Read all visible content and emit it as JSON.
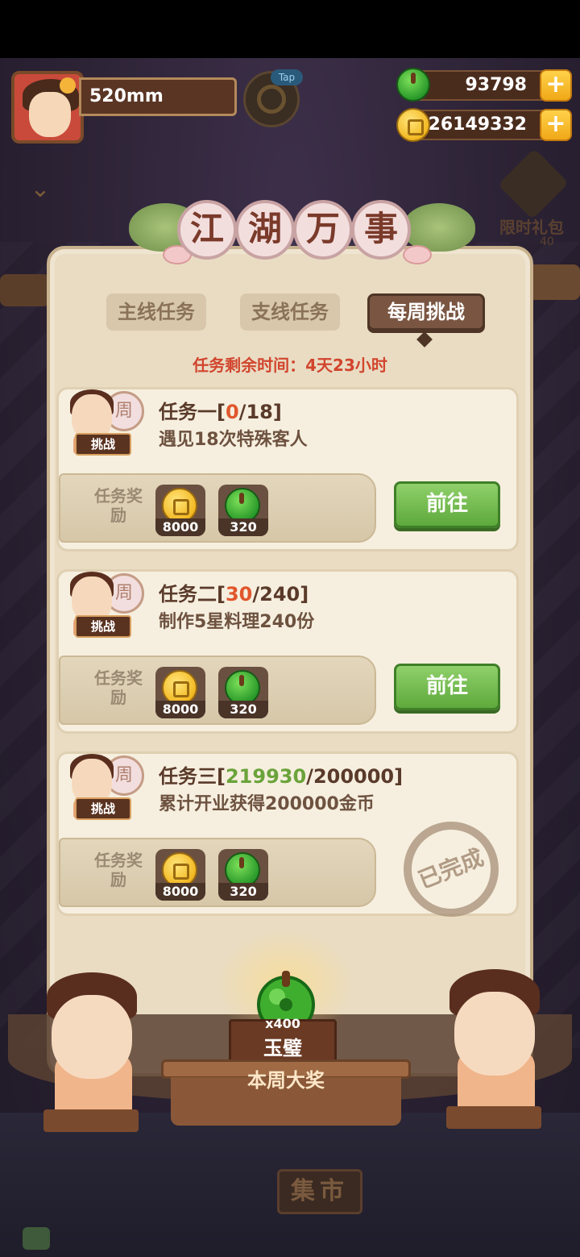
{
  "player": {
    "name": "520mm"
  },
  "tap_label": "Tap",
  "currency": {
    "jade": "93798",
    "coins": "26149332",
    "add_label": "+"
  },
  "side_gift": {
    "label": "限时礼包",
    "sub": "40"
  },
  "panel": {
    "title_chars": [
      "江",
      "湖",
      "万",
      "事"
    ],
    "tabs": [
      {
        "label": "主线任务",
        "active": false
      },
      {
        "label": "支线任务",
        "active": false
      },
      {
        "label": "每周挑战",
        "active": true
      }
    ],
    "remaining": "任务剩余时间：4天23小时"
  },
  "tasks": [
    {
      "name": "任务一",
      "open": "[",
      "progress": "0",
      "slash_total": "/18]",
      "progress_color": "red",
      "desc": "遇见18次特殊客人",
      "tag": "挑战",
      "fan": "周",
      "reward_label": "任务奖励",
      "rewards": [
        {
          "icon": "coin-icon",
          "value": "8000"
        },
        {
          "icon": "jade-icon",
          "value": "320"
        }
      ],
      "action": "前往",
      "done": false
    },
    {
      "name": "任务二",
      "open": "[",
      "progress": "30",
      "slash_total": "/240]",
      "progress_color": "red",
      "desc": "制作5星料理240份",
      "tag": "挑战",
      "fan": "周",
      "reward_label": "任务奖励",
      "rewards": [
        {
          "icon": "coin-icon",
          "value": "8000"
        },
        {
          "icon": "jade-icon",
          "value": "320"
        }
      ],
      "action": "前往",
      "done": false
    },
    {
      "name": "任务三",
      "open": "[",
      "progress": "219930",
      "slash_total": "/200000]",
      "progress_color": "green",
      "desc": "累计开业获得200000金币",
      "tag": "挑战",
      "fan": "周",
      "reward_label": "任务奖励",
      "rewards": [
        {
          "icon": "coin-icon",
          "value": "8000"
        },
        {
          "icon": "jade-icon",
          "value": "320"
        }
      ],
      "stamp": "已完成",
      "done": true
    }
  ],
  "weekly_prize": {
    "count": "x400",
    "name": "玉璧",
    "label": "本周大奖"
  },
  "market_label": "集市",
  "colors": {
    "accent_red": "#d2452e",
    "progress_red": "#e0572c",
    "progress_green": "#6aa33a",
    "go_button": "#5ea93c"
  }
}
